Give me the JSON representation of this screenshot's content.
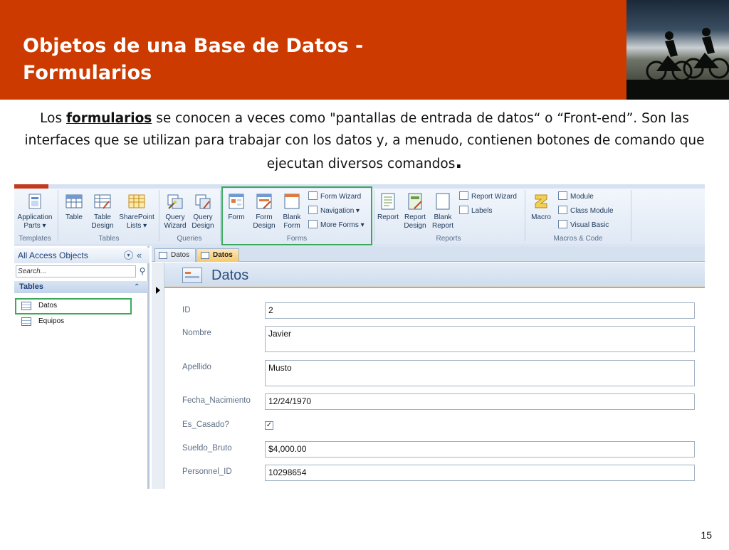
{
  "slide": {
    "title_line1": "Objetos de una Base de Datos -",
    "title_line2": "Formularios",
    "para_pre": "Los ",
    "para_keyword": "formularios",
    "para_post": " se conocen a veces como \"pantallas de entrada de datos“ o “Front-end”. Son las interfaces que se utilizan para trabajar con los datos y,  a menudo, contienen botones de comando que ejecutan diversos comandos",
    "para_end": ".",
    "page_number": "15"
  },
  "ribbon": {
    "templates": {
      "btn": "Application Parts",
      "group": "Templates"
    },
    "tables": {
      "table": "Table",
      "design": "Table Design",
      "sharepoint": "SharePoint Lists",
      "group": "Tables"
    },
    "queries": {
      "wizard": "Query Wizard",
      "design": "Query Design",
      "group": "Queries"
    },
    "forms": {
      "form": "Form",
      "design": "Form Design",
      "blank": "Blank Form",
      "wizard": "Form Wizard",
      "navigation": "Navigation",
      "more": "More Forms",
      "group": "Forms"
    },
    "reports": {
      "report": "Report",
      "design": "Report Design",
      "blank": "Blank Report",
      "wizard": "Report Wizard",
      "labels": "Labels",
      "group": "Reports"
    },
    "macros": {
      "macro": "Macro",
      "module": "Module",
      "class": "Class Module",
      "vb": "Visual Basic",
      "group": "Macros & Code"
    }
  },
  "nav": {
    "header": "All Access Objects",
    "search_placeholder": "Search...",
    "group": "Tables",
    "items": [
      "Datos",
      "Equipos"
    ]
  },
  "doc": {
    "tabs": [
      "Datos",
      "Datos"
    ],
    "form_title": "Datos",
    "fields": [
      {
        "label": "ID",
        "value": "2"
      },
      {
        "label": "Nombre",
        "value": "Javier"
      },
      {
        "label": "Apellido",
        "value": "Musto"
      },
      {
        "label": "Fecha_Nacimiento",
        "value": "12/24/1970"
      },
      {
        "label": "Es_Casado?",
        "value": "✓"
      },
      {
        "label": "Sueldo_Bruto",
        "value": "$4,000.00"
      },
      {
        "label": "Personnel_ID",
        "value": "10298654"
      }
    ]
  },
  "colors": {
    "header": "#cc3a00",
    "highlight": "#3aaa5a",
    "access_blue": "#1e395b"
  }
}
